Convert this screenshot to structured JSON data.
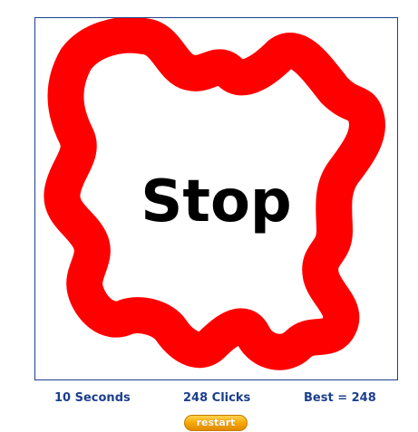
{
  "game": {
    "status_text": "Stop",
    "trail_color": "#ff0000"
  },
  "stats": {
    "seconds_label": "10 Seconds",
    "clicks_label": "248 Clicks",
    "best_label": "Best = 248"
  },
  "controls": {
    "restart_label": "restart"
  },
  "colors": {
    "accent": "#1c3f8c",
    "button": "#f5a400"
  }
}
